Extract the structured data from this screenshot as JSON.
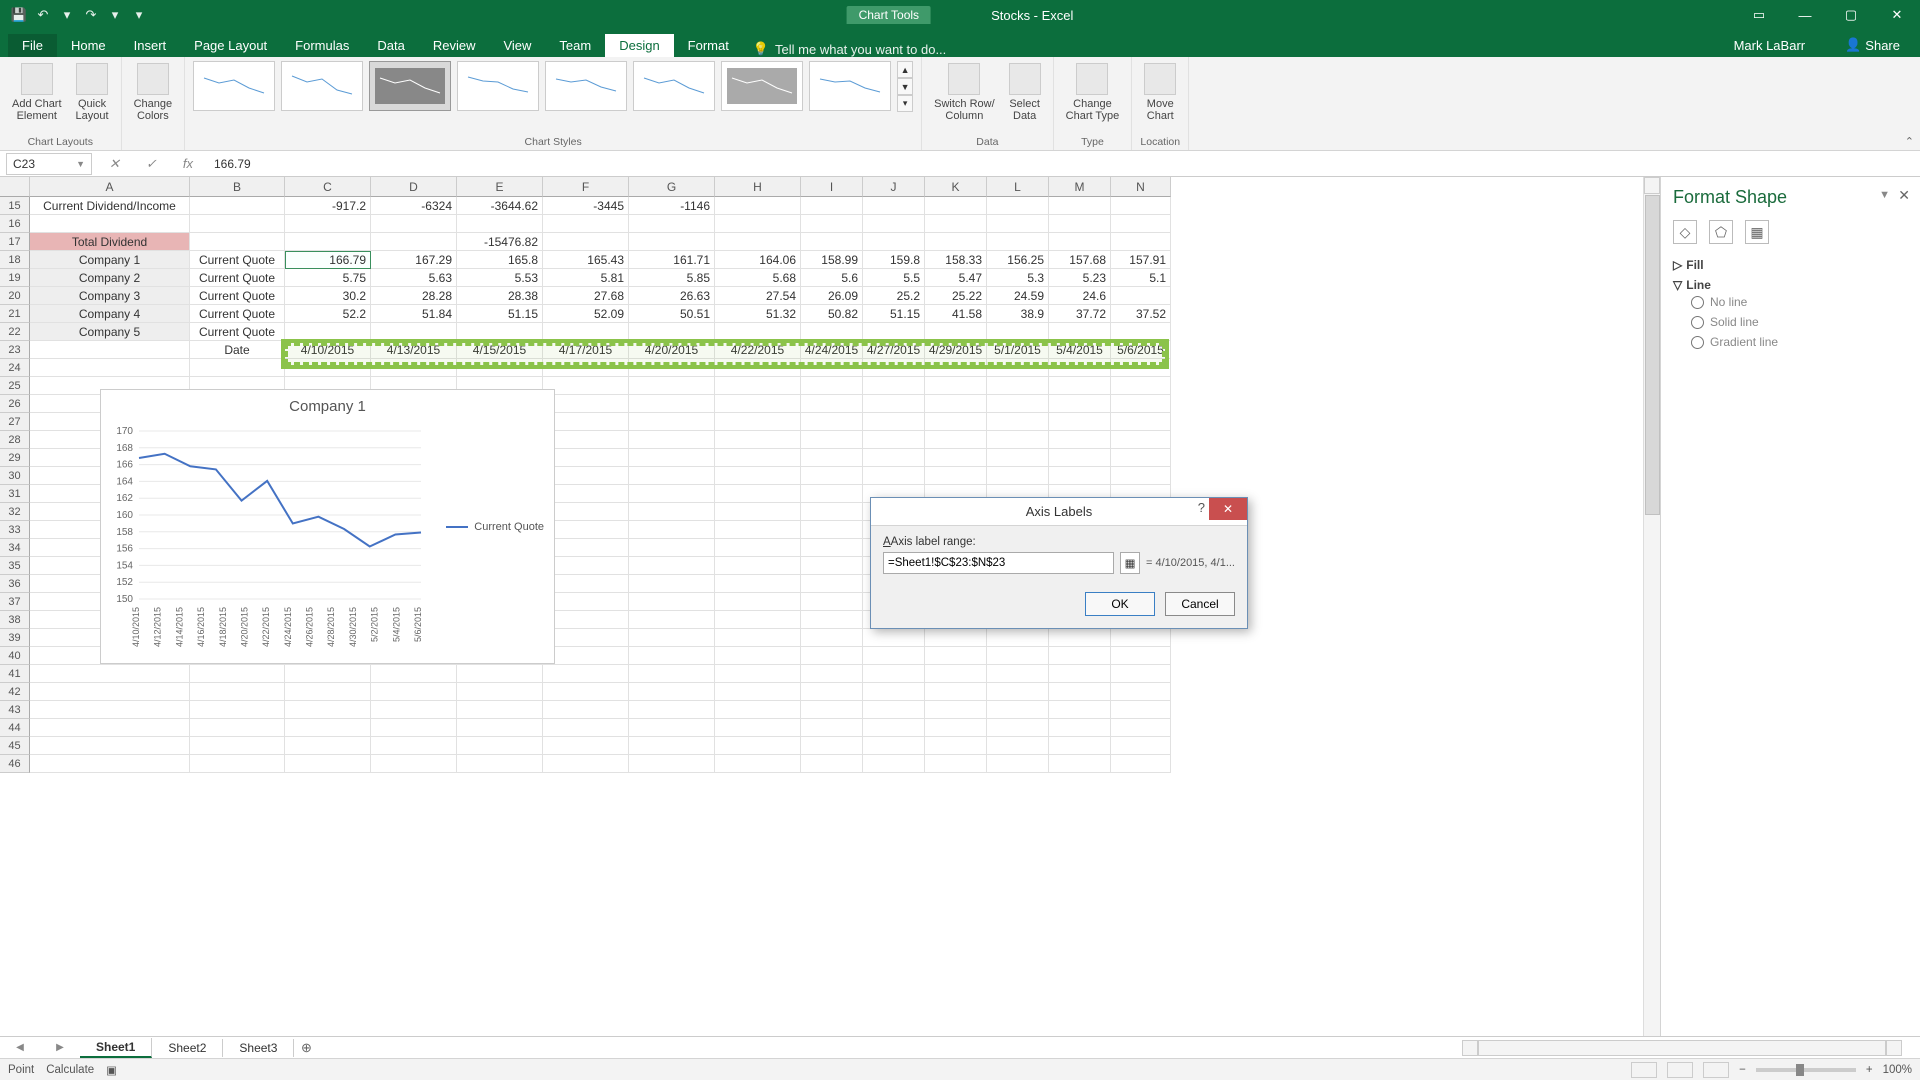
{
  "app": {
    "title": "Stocks - Excel",
    "chart_tools": "Chart Tools"
  },
  "user": "Mark LaBarr",
  "share": "Share",
  "tabs": [
    "File",
    "Home",
    "Insert",
    "Page Layout",
    "Formulas",
    "Data",
    "Review",
    "View",
    "Team",
    "Design",
    "Format"
  ],
  "active_tab": "Design",
  "tellme": "Tell me what you want to do...",
  "ribbon": {
    "btns": {
      "add_chart_el": "Add Chart\nElement",
      "quick_layout": "Quick\nLayout",
      "change_colors": "Change\nColors",
      "switch": "Switch Row/\nColumn",
      "select_data": "Select\nData",
      "change_type": "Change\nChart Type",
      "move_chart": "Move\nChart"
    },
    "groups": {
      "layouts": "Chart Layouts",
      "styles": "Chart Styles",
      "data": "Data",
      "type": "Type",
      "location": "Location"
    }
  },
  "namebox": "C23",
  "formula": "166.79",
  "cols": [
    "A",
    "B",
    "C",
    "D",
    "E",
    "F",
    "G",
    "H",
    "I",
    "J",
    "K",
    "L",
    "M",
    "N"
  ],
  "rownums": [
    15,
    16,
    17,
    18,
    19,
    20,
    21,
    22,
    23,
    24,
    25,
    26,
    27,
    28,
    29,
    30,
    31,
    32,
    33,
    34,
    35,
    36,
    37,
    38,
    39,
    40,
    41,
    42,
    43,
    44,
    45,
    46
  ],
  "rows": {
    "15": {
      "A": "Current Dividend/Income",
      "C": "-917.2",
      "D": "-6324",
      "E": "-3644.62",
      "F": "-3445",
      "G": "-1146"
    },
    "17": {
      "A": "Total Dividend",
      "E": "-15476.82"
    },
    "18": {
      "A": "Company 1",
      "B": "Current Quote",
      "vals": [
        "166.79",
        "167.29",
        "165.8",
        "165.43",
        "161.71",
        "164.06",
        "158.99",
        "159.8",
        "158.33",
        "156.25",
        "157.68",
        "157.91"
      ]
    },
    "19": {
      "A": "Company 2",
      "B": "Current Quote",
      "vals": [
        "5.75",
        "5.63",
        "5.53",
        "5.81",
        "5.85",
        "5.68",
        "5.6",
        "5.5",
        "5.47",
        "5.3",
        "5.23",
        "5.1"
      ]
    },
    "20": {
      "A": "Company 3",
      "B": "Current Quote",
      "vals": [
        "30.2",
        "28.28",
        "28.38",
        "27.68",
        "26.63",
        "27.54",
        "26.09",
        "25.2",
        "25.22",
        "24.59",
        "24.6"
      ]
    },
    "21": {
      "A": "Company 4",
      "B": "Current Quote",
      "vals": [
        "52.2",
        "51.84",
        "51.15",
        "52.09",
        "50.51",
        "51.32",
        "50.82",
        "51.15",
        "41.58",
        "38.9",
        "37.72",
        "37.52"
      ]
    },
    "22": {
      "A": "Company 5",
      "B": "Current Quote"
    },
    "23": {
      "B": "Date",
      "vals": [
        "4/10/2015",
        "4/13/2015",
        "4/15/2015",
        "4/17/2015",
        "4/20/2015",
        "4/22/2015",
        "4/24/2015",
        "4/27/2015",
        "4/29/2015",
        "5/1/2015",
        "5/4/2015",
        "5/6/2015"
      ]
    }
  },
  "chart_data": {
    "type": "line",
    "title": "Company 1",
    "series": [
      {
        "name": "Current Quote",
        "values": [
          166.79,
          167.29,
          165.8,
          165.43,
          161.71,
          164.06,
          158.99,
          159.8,
          158.33,
          156.25,
          157.68,
          157.91
        ]
      }
    ],
    "categories": [
      "4/10/2015",
      "4/12/2015",
      "4/14/2015",
      "4/16/2015",
      "4/18/2015",
      "4/20/2015",
      "4/22/2015",
      "4/24/2015",
      "4/26/2015",
      "4/28/2015",
      "4/30/2015",
      "5/2/2015",
      "5/4/2015",
      "5/6/2015"
    ],
    "ylim": [
      150,
      170
    ],
    "y_ticks": [
      150,
      152,
      154,
      156,
      158,
      160,
      162,
      164,
      166,
      168,
      170
    ]
  },
  "pane": {
    "title": "Format Shape",
    "fill": "Fill",
    "line": "Line",
    "opts": [
      "No line",
      "Solid line",
      "Gradient line"
    ]
  },
  "dialog": {
    "title": "Axis Labels",
    "label": "Axis label range:",
    "value": "=Sheet1!$C$23:$N$23",
    "preview": "= 4/10/2015, 4/1...",
    "ok": "OK",
    "cancel": "Cancel"
  },
  "sheets": [
    "Sheet1",
    "Sheet2",
    "Sheet3"
  ],
  "status": {
    "l1": "Point",
    "l2": "Calculate",
    "zoom": "100%"
  }
}
